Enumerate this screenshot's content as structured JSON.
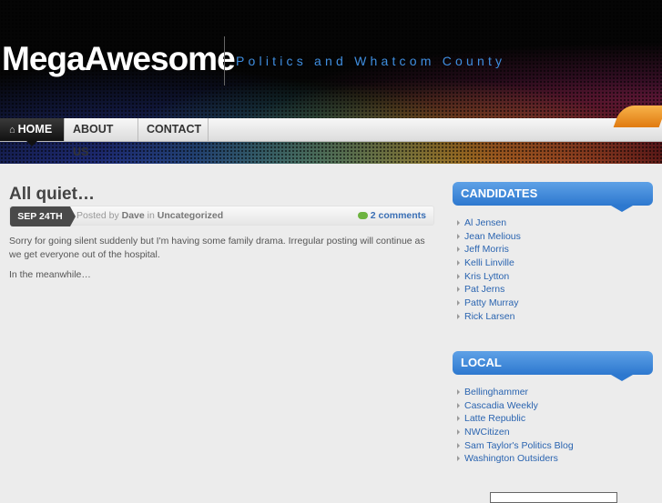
{
  "header": {
    "logo": "MegaAwesome",
    "tagline": "Politics and Whatcom County"
  },
  "nav": {
    "items": [
      "HOME",
      "ABOUT US",
      "CONTACT"
    ]
  },
  "post": {
    "title": "All quiet…",
    "date": "SEP 24TH",
    "posted_by_prefix": "Posted by",
    "author": "Dave",
    "in_label": "in",
    "category": "Uncategorized",
    "comments": "2 comments",
    "paragraphs": [
      "Sorry for going silent suddenly but I'm having some family drama.  Irregular posting will continue as we get everyone out of the hospital.",
      "In the meanwhile…"
    ]
  },
  "sidebar": {
    "candidates": {
      "title": "CANDIDATES",
      "links": [
        "Al Jensen",
        "Jean Melious",
        "Jeff Morris",
        "Kelli Linville",
        "Kris Lytton",
        "Pat Jerns",
        "Patty Murray",
        "Rick Larsen"
      ]
    },
    "local": {
      "title": "LOCAL",
      "links": [
        "Bellinghammer",
        "Cascadia Weekly",
        "Latte Republic",
        "NWCitizen",
        "Sam Taylor's Politics Blog",
        "Washington Outsiders"
      ]
    }
  },
  "icons": [
    "home-icon",
    "rss-icon",
    "comment-bubble-icon"
  ],
  "colors": {
    "accent": "#2d78cf",
    "tagline": "#3f8ee0",
    "link": "#2a64b0"
  }
}
